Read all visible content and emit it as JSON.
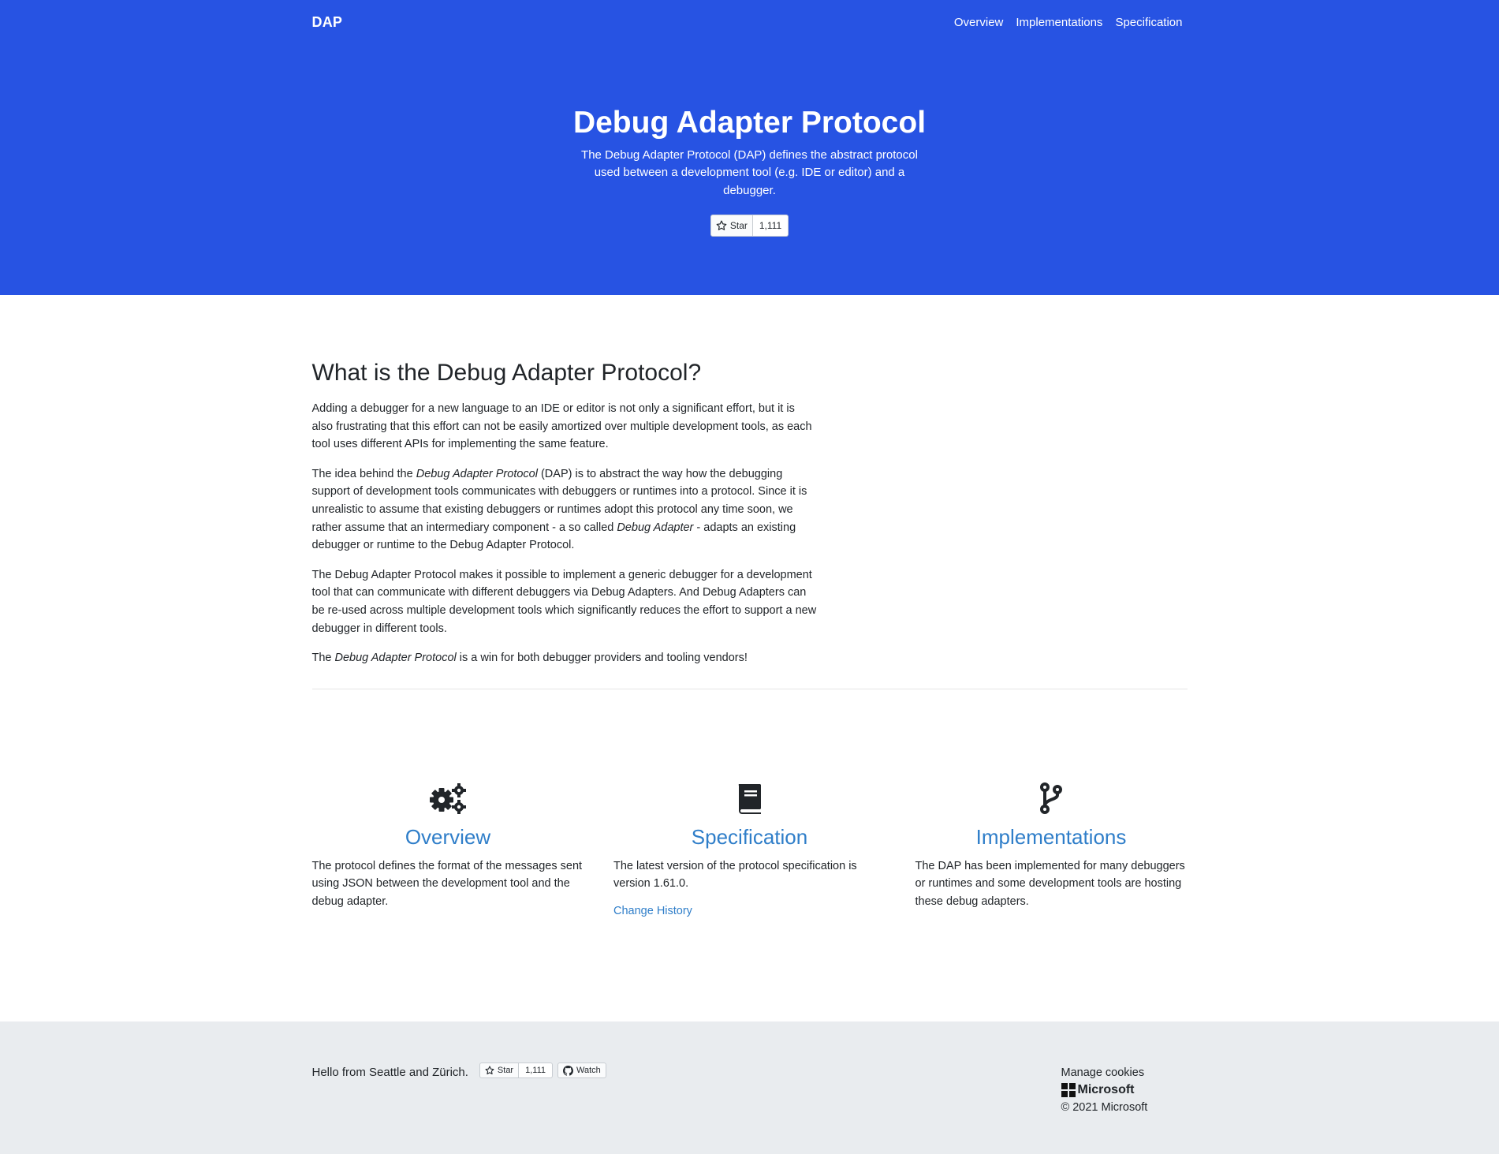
{
  "nav": {
    "brand": "DAP",
    "links": [
      "Overview",
      "Implementations",
      "Specification"
    ]
  },
  "hero": {
    "title": "Debug Adapter Protocol",
    "lead": "The Debug Adapter Protocol (DAP) defines the abstract protocol used between a development tool (e.g. IDE or editor) and a debugger.",
    "star_label": "Star",
    "star_count": "1,111"
  },
  "intro": {
    "heading": "What is the Debug Adapter Protocol?",
    "p1": "Adding a debugger for a new language to an IDE or editor is not only a significant effort, but it is also frustrating that this effort can not be easily amortized over multiple development tools, as each tool uses different APIs for implementing the same feature.",
    "p2_a": "The idea behind the ",
    "p2_em1": "Debug Adapter Protocol",
    "p2_b": " (DAP) is to abstract the way how the debugging support of development tools communicates with debuggers or runtimes into a protocol. Since it is unrealistic to assume that existing debuggers or runtimes adopt this protocol any time soon, we rather assume that an intermediary component - a so called ",
    "p2_em2": "Debug Adapter",
    "p2_c": " - adapts an existing debugger or runtime to the Debug Adapter Protocol.",
    "p3": "The Debug Adapter Protocol makes it possible to implement a generic debugger for a development tool that can communicate with different debuggers via Debug Adapters. And Debug Adapters can be re-used across multiple development tools which significantly reduces the effort to support a new debugger in different tools.",
    "p4_a": "The ",
    "p4_em": "Debug Adapter Protocol",
    "p4_b": " is a win for both debugger providers and tooling vendors!"
  },
  "features": [
    {
      "icon": "cogs-icon",
      "title": "Overview",
      "text": "The protocol defines the format of the messages sent using JSON between the development tool and the debug adapter."
    },
    {
      "icon": "book-icon",
      "title": "Specification",
      "text": "The latest version of the protocol specification is version 1.61.0.",
      "link": "Change History"
    },
    {
      "icon": "code-branch-icon",
      "title": "Implementations",
      "text": "The DAP has been implemented for many debuggers or runtimes and some development tools are hosting these debug adapters."
    }
  ],
  "footer": {
    "hello": "Hello from Seattle and Zürich.",
    "star_label": "Star",
    "star_count": "1,111",
    "watch_label": "Watch",
    "manage_cookies": "Manage cookies",
    "ms_logo_text": "Microsoft",
    "copyright": "© 2021 Microsoft"
  },
  "colors": {
    "hero_bg": "#2753e3",
    "link": "#2f7ec9",
    "footer_bg": "#e9ecef"
  }
}
